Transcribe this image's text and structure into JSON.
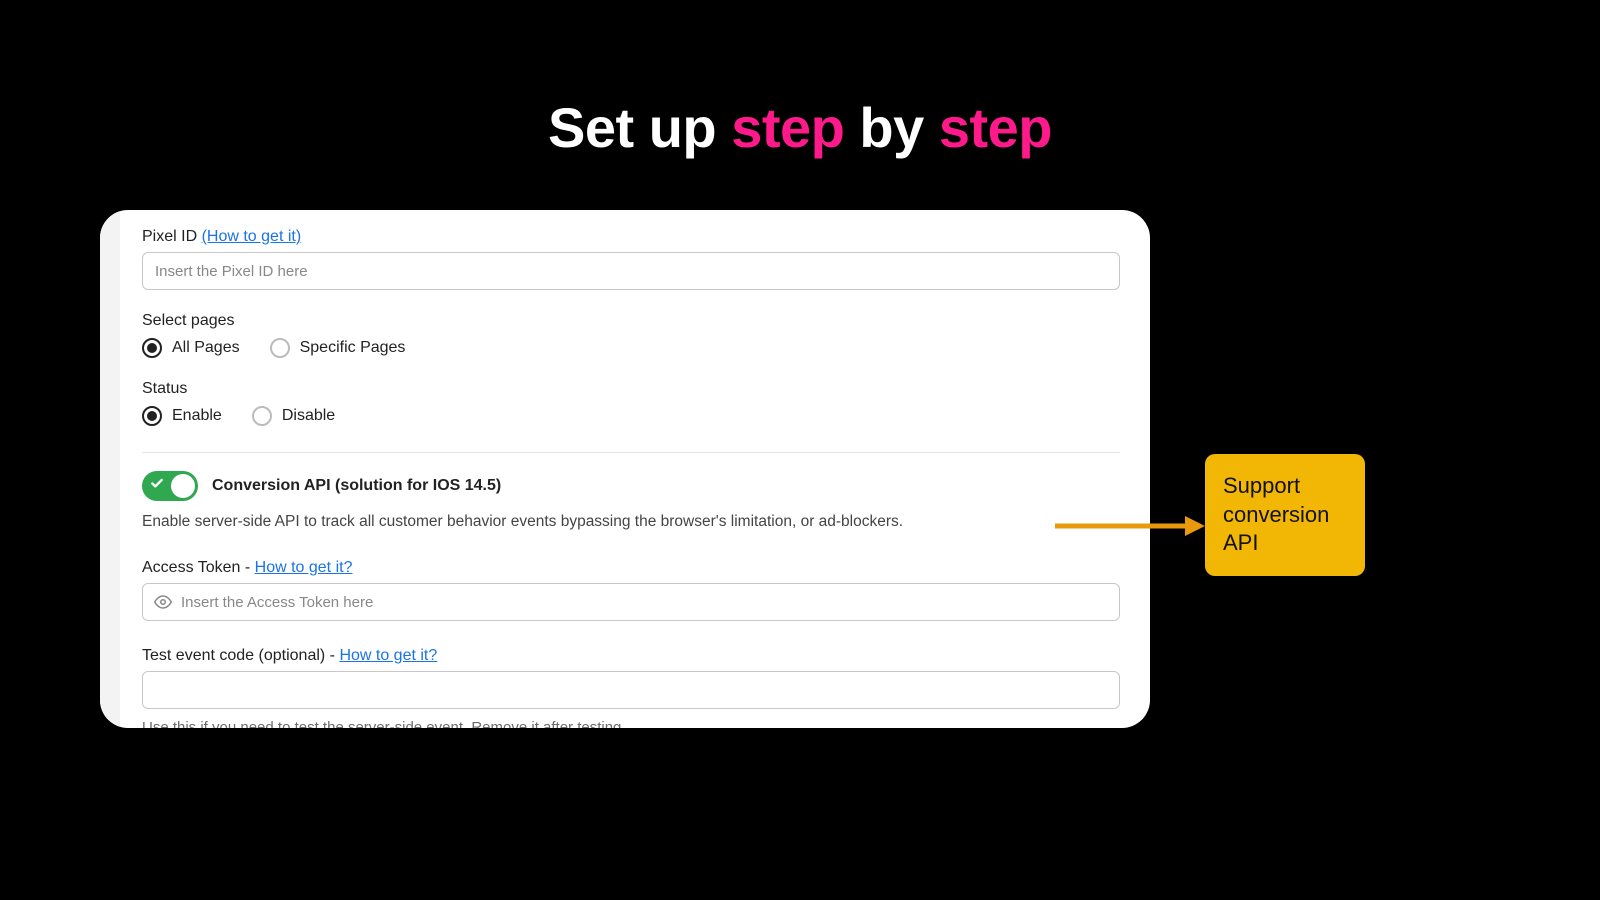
{
  "hero": {
    "part1": "Set up ",
    "accent1": "step",
    "part2": " by ",
    "accent2": "step"
  },
  "form": {
    "pixel_id": {
      "label": "Pixel ID ",
      "link": "(How to get it)",
      "placeholder": "Insert the Pixel ID here"
    },
    "select_pages": {
      "label": "Select pages",
      "options": {
        "all": "All Pages",
        "specific": "Specific Pages"
      }
    },
    "status": {
      "label": "Status",
      "options": {
        "enable": "Enable",
        "disable": "Disable"
      }
    },
    "conversion_api": {
      "title": "Conversion API (solution for IOS 14.5)",
      "description": "Enable server-side API to track all customer behavior events bypassing the browser's limitation, or ad-blockers."
    },
    "access_token": {
      "label_prefix": "Access Token - ",
      "link": "How to get it?",
      "placeholder": "Insert the Access Token here"
    },
    "test_event": {
      "label_prefix": "Test event code (optional) - ",
      "link": "How to get it?",
      "hint": "Use this if you need to test the server-side event. Remove it after testing"
    }
  },
  "callout": {
    "text": "Support conversion API"
  }
}
